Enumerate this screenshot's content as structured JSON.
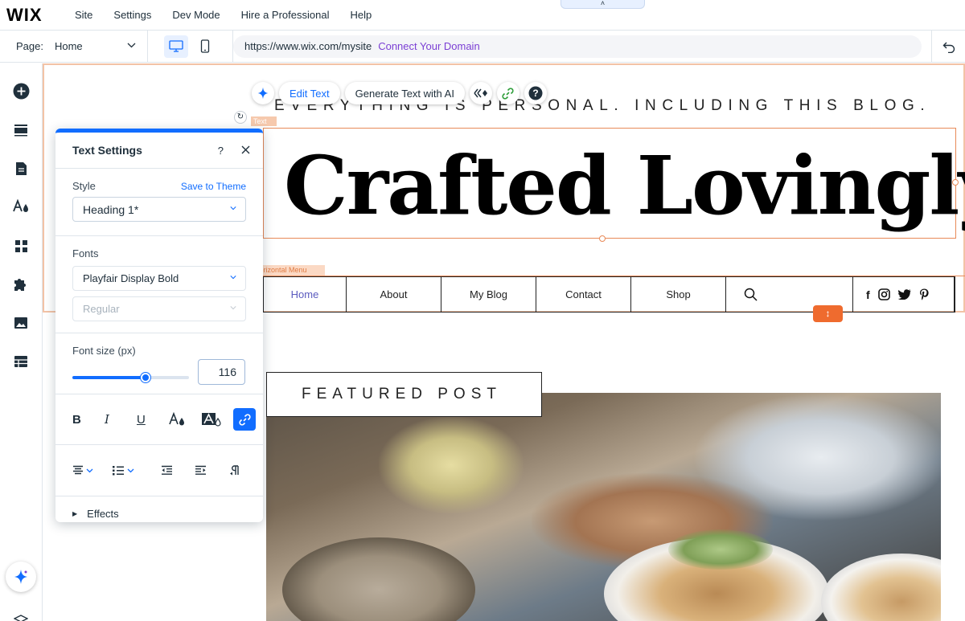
{
  "app": {
    "logo": "WIX",
    "menu": [
      "Site",
      "Settings",
      "Dev Mode",
      "Hire a Professional",
      "Help"
    ],
    "collapse_glyph": "˄"
  },
  "pagebar": {
    "page_label": "Page:",
    "page_value": "Home",
    "url": "https://www.wix.com/mysite",
    "connect_domain": "Connect Your Domain"
  },
  "sidebar": {
    "items": [
      "add-elements",
      "sections",
      "pages",
      "site-design",
      "apps",
      "business-apps",
      "media",
      "cms"
    ]
  },
  "floating_toolbar": {
    "edit_text": "Edit Text",
    "generate_ai": "Generate Text with AI"
  },
  "site": {
    "tagline": "EVERYTHING IS PERSONAL. INCLUDING THIS BLOG.",
    "text_tag": "Text",
    "heading": "Crafted Lovingly",
    "menu_tag": "Horizontal Menu",
    "menu_items": [
      "Home",
      "About",
      "My Blog",
      "Contact",
      "Shop"
    ],
    "featured": "FEATURED POST"
  },
  "text_settings": {
    "title": "Text Settings",
    "help": "?",
    "style_label": "Style",
    "save_theme": "Save to Theme",
    "style_value": "Heading 1*",
    "fonts_label": "Fonts",
    "font_value": "Playfair Display Bold",
    "weight_value": "Regular",
    "size_label": "Font size (px)",
    "size_value": "116",
    "size_slider_fraction": 0.63,
    "bold": "B",
    "italic": "I",
    "underline": "U",
    "effects_label": "Effects"
  },
  "colors": {
    "accent": "#116dff",
    "selection": "#e88a58",
    "stretch": "#ef6b2e",
    "connect": "#7b3fd4"
  }
}
